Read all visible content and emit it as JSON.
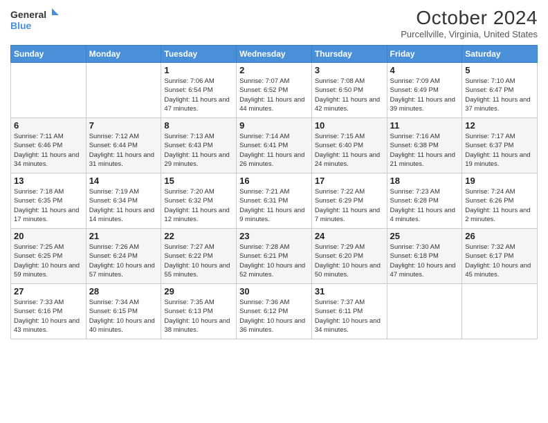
{
  "header": {
    "logo_line1": "General",
    "logo_line2": "Blue",
    "title": "October 2024",
    "subtitle": "Purcellville, Virginia, United States"
  },
  "calendar": {
    "days_of_week": [
      "Sunday",
      "Monday",
      "Tuesday",
      "Wednesday",
      "Thursday",
      "Friday",
      "Saturday"
    ],
    "weeks": [
      [
        {
          "day": "",
          "info": ""
        },
        {
          "day": "",
          "info": ""
        },
        {
          "day": "1",
          "info": "Sunrise: 7:06 AM\nSunset: 6:54 PM\nDaylight: 11 hours and 47 minutes."
        },
        {
          "day": "2",
          "info": "Sunrise: 7:07 AM\nSunset: 6:52 PM\nDaylight: 11 hours and 44 minutes."
        },
        {
          "day": "3",
          "info": "Sunrise: 7:08 AM\nSunset: 6:50 PM\nDaylight: 11 hours and 42 minutes."
        },
        {
          "day": "4",
          "info": "Sunrise: 7:09 AM\nSunset: 6:49 PM\nDaylight: 11 hours and 39 minutes."
        },
        {
          "day": "5",
          "info": "Sunrise: 7:10 AM\nSunset: 6:47 PM\nDaylight: 11 hours and 37 minutes."
        }
      ],
      [
        {
          "day": "6",
          "info": "Sunrise: 7:11 AM\nSunset: 6:46 PM\nDaylight: 11 hours and 34 minutes."
        },
        {
          "day": "7",
          "info": "Sunrise: 7:12 AM\nSunset: 6:44 PM\nDaylight: 11 hours and 31 minutes."
        },
        {
          "day": "8",
          "info": "Sunrise: 7:13 AM\nSunset: 6:43 PM\nDaylight: 11 hours and 29 minutes."
        },
        {
          "day": "9",
          "info": "Sunrise: 7:14 AM\nSunset: 6:41 PM\nDaylight: 11 hours and 26 minutes."
        },
        {
          "day": "10",
          "info": "Sunrise: 7:15 AM\nSunset: 6:40 PM\nDaylight: 11 hours and 24 minutes."
        },
        {
          "day": "11",
          "info": "Sunrise: 7:16 AM\nSunset: 6:38 PM\nDaylight: 11 hours and 21 minutes."
        },
        {
          "day": "12",
          "info": "Sunrise: 7:17 AM\nSunset: 6:37 PM\nDaylight: 11 hours and 19 minutes."
        }
      ],
      [
        {
          "day": "13",
          "info": "Sunrise: 7:18 AM\nSunset: 6:35 PM\nDaylight: 11 hours and 17 minutes."
        },
        {
          "day": "14",
          "info": "Sunrise: 7:19 AM\nSunset: 6:34 PM\nDaylight: 11 hours and 14 minutes."
        },
        {
          "day": "15",
          "info": "Sunrise: 7:20 AM\nSunset: 6:32 PM\nDaylight: 11 hours and 12 minutes."
        },
        {
          "day": "16",
          "info": "Sunrise: 7:21 AM\nSunset: 6:31 PM\nDaylight: 11 hours and 9 minutes."
        },
        {
          "day": "17",
          "info": "Sunrise: 7:22 AM\nSunset: 6:29 PM\nDaylight: 11 hours and 7 minutes."
        },
        {
          "day": "18",
          "info": "Sunrise: 7:23 AM\nSunset: 6:28 PM\nDaylight: 11 hours and 4 minutes."
        },
        {
          "day": "19",
          "info": "Sunrise: 7:24 AM\nSunset: 6:26 PM\nDaylight: 11 hours and 2 minutes."
        }
      ],
      [
        {
          "day": "20",
          "info": "Sunrise: 7:25 AM\nSunset: 6:25 PM\nDaylight: 10 hours and 59 minutes."
        },
        {
          "day": "21",
          "info": "Sunrise: 7:26 AM\nSunset: 6:24 PM\nDaylight: 10 hours and 57 minutes."
        },
        {
          "day": "22",
          "info": "Sunrise: 7:27 AM\nSunset: 6:22 PM\nDaylight: 10 hours and 55 minutes."
        },
        {
          "day": "23",
          "info": "Sunrise: 7:28 AM\nSunset: 6:21 PM\nDaylight: 10 hours and 52 minutes."
        },
        {
          "day": "24",
          "info": "Sunrise: 7:29 AM\nSunset: 6:20 PM\nDaylight: 10 hours and 50 minutes."
        },
        {
          "day": "25",
          "info": "Sunrise: 7:30 AM\nSunset: 6:18 PM\nDaylight: 10 hours and 47 minutes."
        },
        {
          "day": "26",
          "info": "Sunrise: 7:32 AM\nSunset: 6:17 PM\nDaylight: 10 hours and 45 minutes."
        }
      ],
      [
        {
          "day": "27",
          "info": "Sunrise: 7:33 AM\nSunset: 6:16 PM\nDaylight: 10 hours and 43 minutes."
        },
        {
          "day": "28",
          "info": "Sunrise: 7:34 AM\nSunset: 6:15 PM\nDaylight: 10 hours and 40 minutes."
        },
        {
          "day": "29",
          "info": "Sunrise: 7:35 AM\nSunset: 6:13 PM\nDaylight: 10 hours and 38 minutes."
        },
        {
          "day": "30",
          "info": "Sunrise: 7:36 AM\nSunset: 6:12 PM\nDaylight: 10 hours and 36 minutes."
        },
        {
          "day": "31",
          "info": "Sunrise: 7:37 AM\nSunset: 6:11 PM\nDaylight: 10 hours and 34 minutes."
        },
        {
          "day": "",
          "info": ""
        },
        {
          "day": "",
          "info": ""
        }
      ]
    ]
  }
}
